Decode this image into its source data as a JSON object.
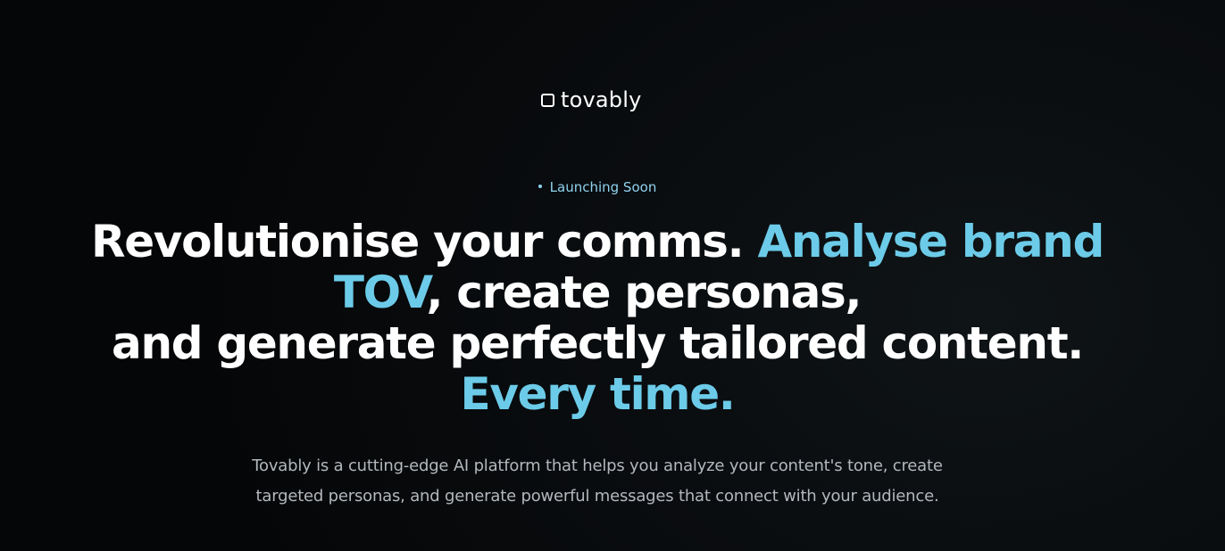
{
  "brand": {
    "logo_icon": "rounded-square-logo-icon",
    "name": "tovably"
  },
  "badge": {
    "label": "Launching Soon"
  },
  "hero": {
    "line1_white": "Revolutionise your comms. ",
    "line1_accent": "Analyse brand",
    "line2_accent": "TOV",
    "line2_white": ", create personas,",
    "line3_white": "and generate perfectly tailored content.",
    "line4_accent": "Every time.",
    "description": "Tovably is a cutting-edge AI platform that helps you analyze your content's tone, create targeted personas, and generate powerful messages that connect with your audience."
  },
  "colors": {
    "background": "#050607",
    "accent": "#6ccbe8",
    "badge": "#8fd3ee",
    "body_text": "#b3b8bd"
  }
}
